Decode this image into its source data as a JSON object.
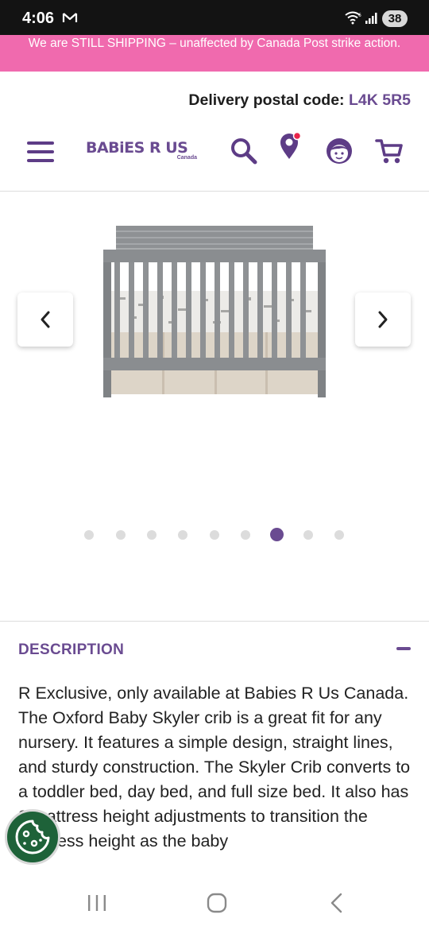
{
  "status_bar": {
    "time": "4:06",
    "battery": "38",
    "icons": [
      "gmail-icon",
      "wifi-icon",
      "signal-icon",
      "battery-icon"
    ]
  },
  "promo_banner": {
    "text": "We are STILL SHIPPING – unaffected by Canada Post strike action."
  },
  "delivery": {
    "label": "Delivery postal code:",
    "code": "L4K 5R5"
  },
  "header": {
    "logo_text": "BABiES R US",
    "logo_sub": "Canada",
    "icons": [
      "menu-icon",
      "search-icon",
      "location-pin-icon",
      "account-icon",
      "cart-icon"
    ]
  },
  "carousel": {
    "image_alt": "grey convertible crib",
    "dot_count": 9,
    "active_index": 6
  },
  "description": {
    "title": "DESCRIPTION",
    "body": "R Exclusive, only available at Babies R Us Canada. The Oxford Baby Skyler crib is a great fit for any nursery. It features a simple design, straight lines, and sturdy construction. The Skyler Crib converts to a toddler bed, day bed, and full size bed. It also has 3 mattress height adjustments to transition the mattress height as the baby"
  },
  "colors": {
    "brand_purple": "#6a4b91",
    "promo_pink": "#f06aae",
    "cookie_green": "#1e6239"
  }
}
